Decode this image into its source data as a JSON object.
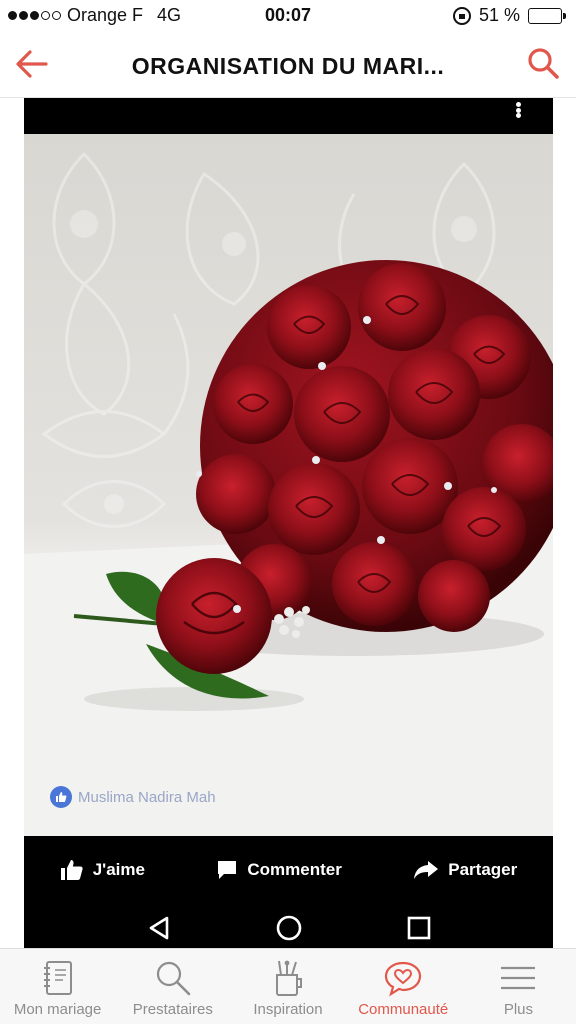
{
  "status_bar": {
    "carrier": "Orange F",
    "network": "4G",
    "time": "00:07",
    "battery": "51 %",
    "battery_level": 0.51
  },
  "header": {
    "title": "ORGANISATION DU MARI...",
    "accent_color": "#e2574c"
  },
  "post": {
    "credit": "Muslima Nadira Mah",
    "actions": {
      "like": "J'aime",
      "comment": "Commenter",
      "share": "Partager"
    }
  },
  "tabbar": {
    "items": [
      {
        "label": "Mon mariage",
        "icon": "notebook-icon"
      },
      {
        "label": "Prestataires",
        "icon": "search-icon"
      },
      {
        "label": "Inspiration",
        "icon": "tools-cup-icon"
      },
      {
        "label": "Communauté",
        "icon": "heart-bubble-icon",
        "active": true
      },
      {
        "label": "Plus",
        "icon": "hamburger-menu-icon"
      }
    ]
  }
}
